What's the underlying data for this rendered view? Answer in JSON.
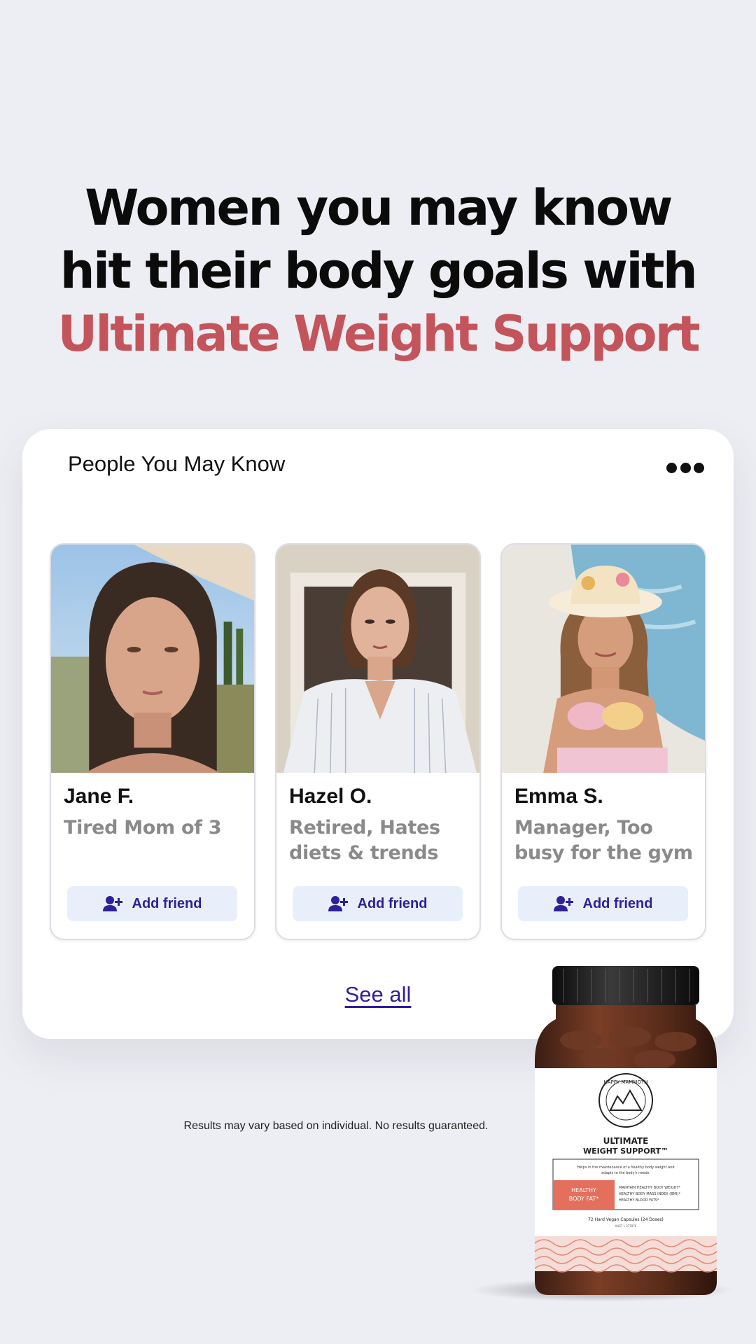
{
  "headline": {
    "line1": "Women you may know",
    "line2": "hit their body goals with",
    "line3": "Ultimate Weight Support"
  },
  "card": {
    "title": "People You May Know",
    "more_icon": "more-horizontal-icon",
    "people": [
      {
        "name": "Jane F.",
        "description": "Tired Mom of 3",
        "button": "Add friend"
      },
      {
        "name": "Hazel O.",
        "description": "Retired, Hates diets & trends",
        "button": "Add friend"
      },
      {
        "name": "Emma S.",
        "description": "Manager, Too busy for the gym",
        "button": "Add friend"
      }
    ],
    "see_all": "See all"
  },
  "disclaimer": "Results may vary based on individual. No results guaranteed.",
  "product": {
    "brand": "HAPPY MAMMOTH",
    "name_line1": "ULTIMATE",
    "name_line2": "WEIGHT SUPPORT™",
    "blurb": "Helps in the maintenance of a healthy body weight and adapts to the body's needs.",
    "badge": "HEALTHY BODY FAT*",
    "claims": "MAINTAIN HEALTHY BODY WEIGHT* HEALTHY BODY MASS INDEX (BMI)* HEALTHY BLOOD FATS*",
    "count": "72 Hard Vegan Capsules (24 Doses)",
    "code": "AUST L 377070"
  },
  "colors": {
    "accent": "#c4545b",
    "link": "#2d1f9c",
    "button_bg": "#e9effa",
    "button_text": "#2b2297",
    "background": "#edeef3"
  }
}
